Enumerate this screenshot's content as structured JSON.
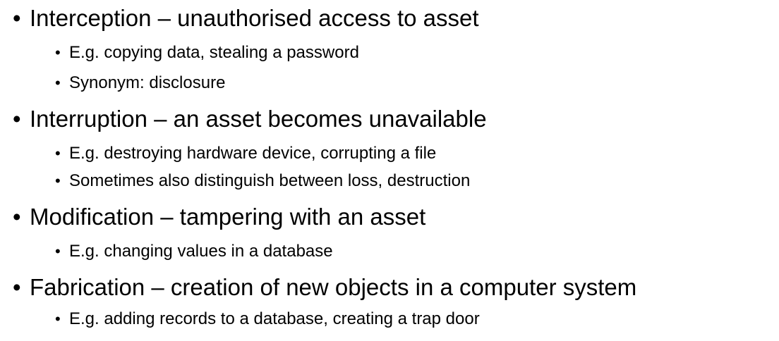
{
  "slide": {
    "bullet_glyph": "•",
    "items": [
      {
        "text": "Interception – unauthorised access to asset",
        "subitems": [
          "E.g. copying data, stealing a password",
          "Synonym: disclosure"
        ]
      },
      {
        "text": "Interruption – an asset becomes unavailable",
        "subitems": [
          "E.g. destroying hardware device, corrupting a file",
          "Sometimes also distinguish between loss, destruction"
        ]
      },
      {
        "text": "Modification – tampering with an asset",
        "subitems": [
          "E.g. changing values in a database"
        ]
      },
      {
        "text": "Fabrication – creation of new objects in a computer system",
        "subitems": [
          "E.g. adding records to a database, creating a trap door"
        ]
      }
    ]
  }
}
